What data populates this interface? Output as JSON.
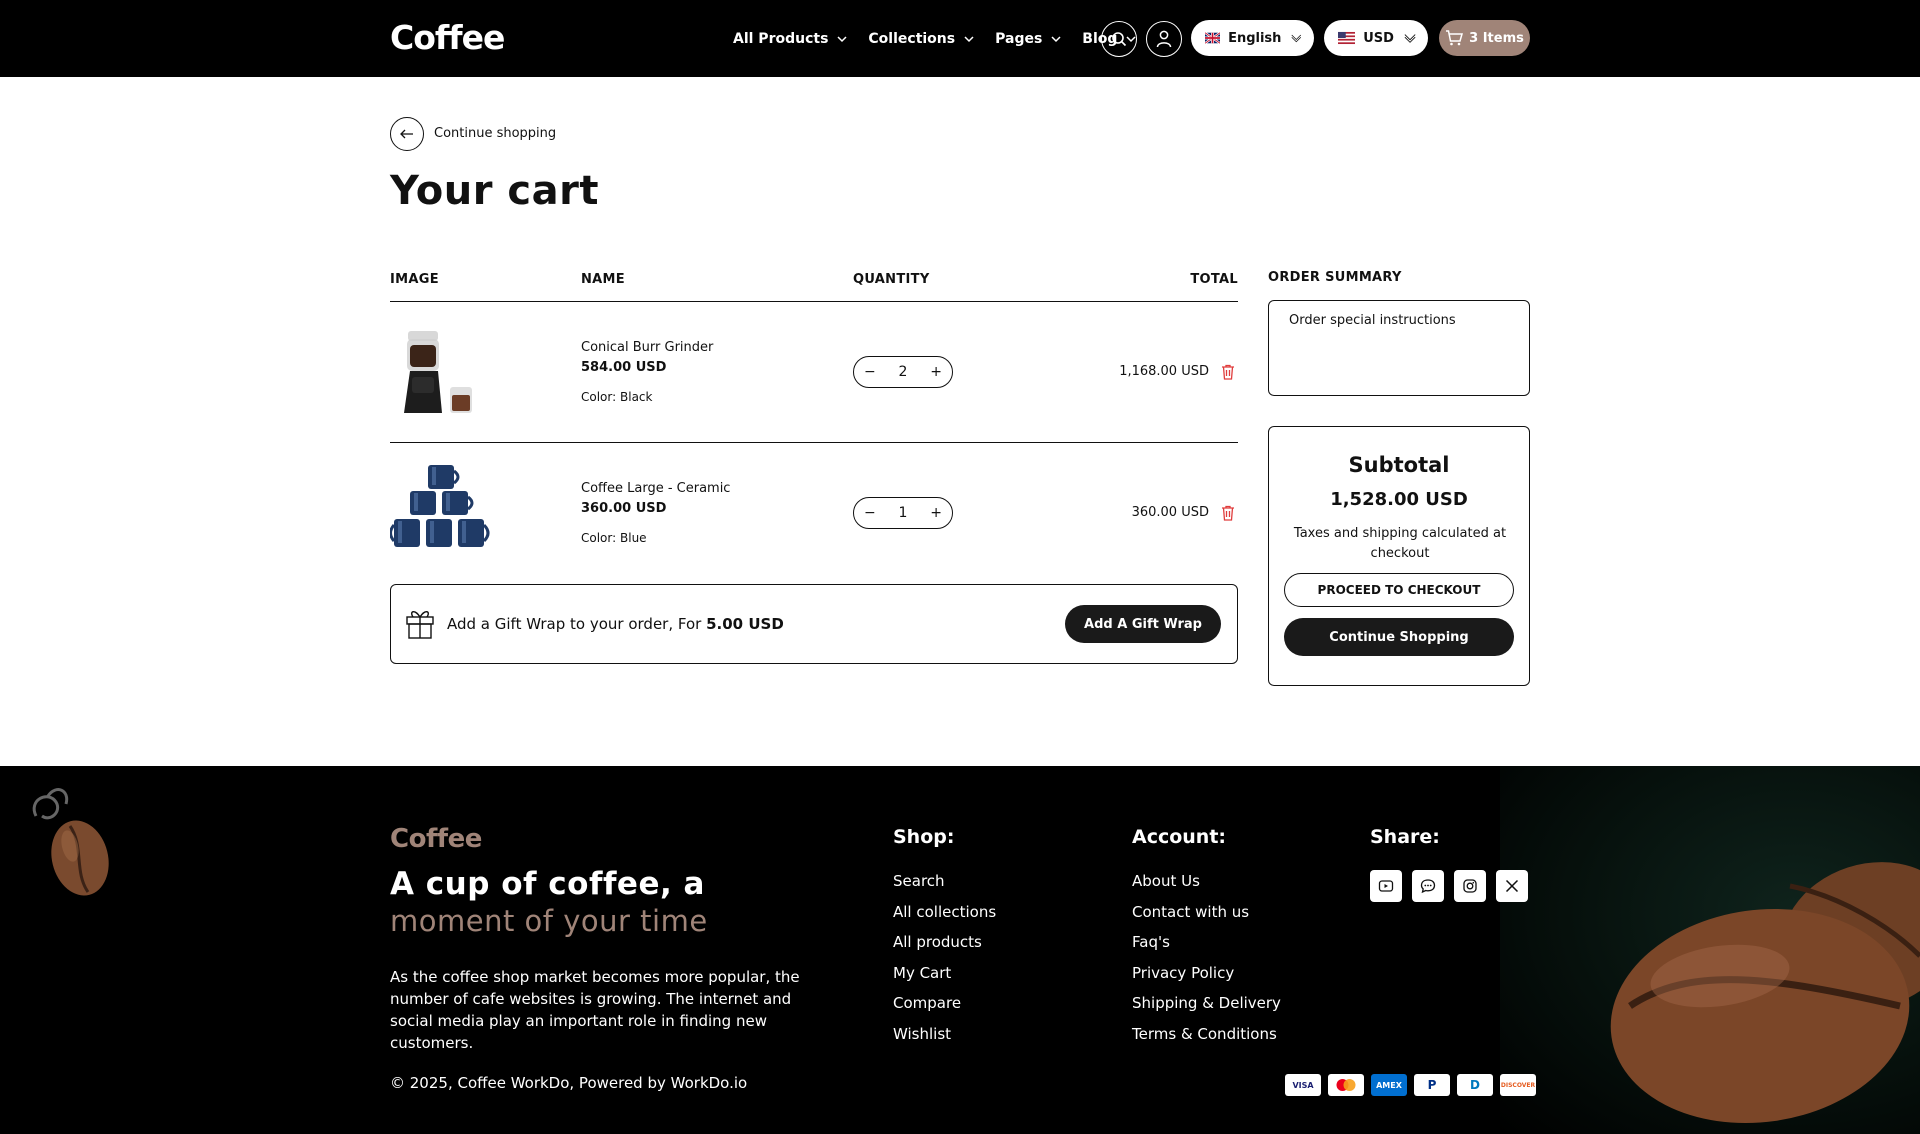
{
  "header": {
    "logo": "Coffee",
    "nav": [
      {
        "label": "All Products"
      },
      {
        "label": "Collections"
      },
      {
        "label": "Pages"
      },
      {
        "label": "Blog"
      }
    ],
    "language": "English",
    "currency": "USD",
    "cart_count": "3 Items"
  },
  "main": {
    "back_label": "Continue shopping",
    "title": "Your cart",
    "columns": [
      "IMAGE",
      "NAME",
      "QUANTITY",
      "TOTAL"
    ],
    "items": [
      {
        "name": "Conical Burr Grinder",
        "price": "584.00 USD",
        "color_label": "Color:",
        "color": "Black",
        "quantity": "2",
        "total": "1,168.00 USD"
      },
      {
        "name": "Coffee Large - Ceramic",
        "price": "360.00 USD",
        "color_label": "Color:",
        "color": "Blue",
        "quantity": "1",
        "total": "360.00 USD"
      }
    ],
    "gift": {
      "text": "Add a Gift Wrap to your order, For ",
      "amount": "5.00 USD",
      "button": "Add A Gift Wrap"
    }
  },
  "summary": {
    "title": "ORDER SUMMARY",
    "notes_placeholder": "Order special instructions",
    "subtotal_label": "Subtotal",
    "subtotal": "1,528.00 USD",
    "note": "Taxes and shipping calculated at checkout",
    "checkout": "PROCEED TO CHECKOUT",
    "continue": "Continue Shopping"
  },
  "footer": {
    "logo": "Coffee",
    "tagline1": "A cup of coffee, a",
    "tagline2": "moment of your time",
    "description": "As the coffee shop market becomes more popular, the number of cafe websites is growing. The internet and social media play an important role in finding new customers.",
    "copyright": "© 2025, Coffee WorkDo, Powered by WorkDo.io",
    "shop_title": "Shop:",
    "shop_links": [
      "Search",
      "All collections",
      "All products",
      "My Cart",
      "Compare",
      "Wishlist"
    ],
    "account_title": "Account:",
    "account_links": [
      "About Us",
      "Contact with us",
      "Faq's",
      "Privacy Policy",
      "Shipping & Delivery",
      "Terms & Conditions"
    ],
    "share_title": "Share:",
    "share_icons": [
      "youtube-icon",
      "chat-icon",
      "instagram-icon",
      "x-icon"
    ],
    "payments": [
      {
        "label": "VISA",
        "bg": "#ffffff",
        "fg": "#1a1f71"
      },
      {
        "label": "",
        "bg": "#ffffff",
        "fg": "#eb001b"
      },
      {
        "label": "AMEX",
        "bg": "#016fd0",
        "fg": "#ffffff"
      },
      {
        "label": "P",
        "bg": "#ffffff",
        "fg": "#003087"
      },
      {
        "label": "D",
        "bg": "#ffffff",
        "fg": "#0079be"
      },
      {
        "label": "DISCOVER",
        "bg": "#ffffff",
        "fg": "#e55c20"
      }
    ]
  },
  "colors": {
    "accent": "#a08478",
    "dark": "#1a1a1a",
    "trash": "#e03c3c"
  }
}
